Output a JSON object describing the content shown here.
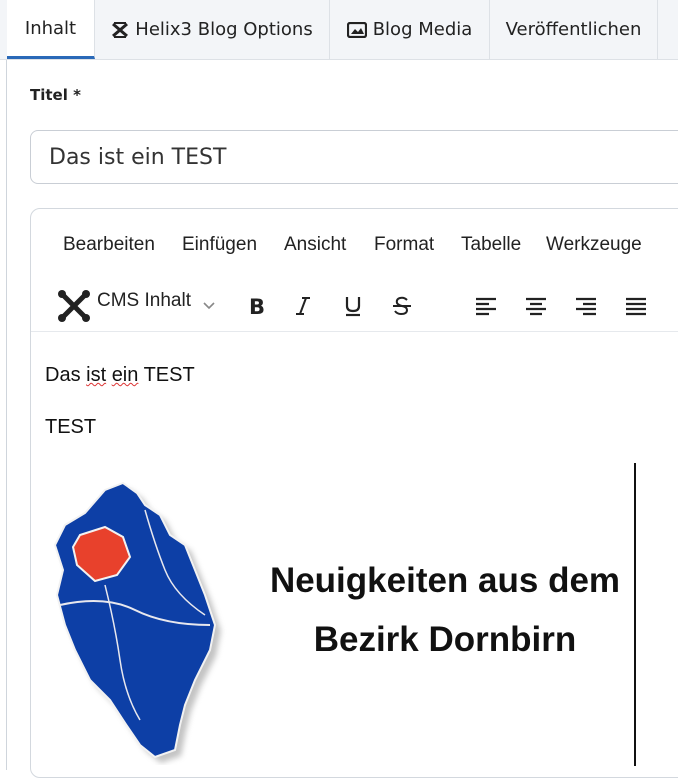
{
  "tabs": [
    {
      "label": "Inhalt",
      "active": true
    },
    {
      "label": "Helix3 Blog Options",
      "icon": "helix-icon"
    },
    {
      "label": "Blog Media",
      "icon": "image-icon"
    },
    {
      "label": "Veröffentlichen"
    }
  ],
  "form": {
    "title_label": "Titel *",
    "title_value": "Das ist ein TEST"
  },
  "editor": {
    "menu": [
      "Bearbeiten",
      "Einfügen",
      "Ansicht",
      "Format",
      "Tabelle",
      "Werkzeuge"
    ],
    "toolbar": {
      "cms_label": "CMS Inhalt",
      "buttons": [
        "bold-icon",
        "italic-icon",
        "underline-icon",
        "strikethrough-icon",
        "align-left-icon",
        "align-center-icon",
        "align-right-icon",
        "align-justify-icon"
      ]
    },
    "content": {
      "line1_a": "Das ",
      "line1_b": "ist",
      "line1_c": " ",
      "line1_d": "ein",
      "line1_e": " TEST",
      "line2": "TEST",
      "banner_line1": "Neuigkeiten aus dem",
      "banner_line2": "Bezirk Dornbirn"
    }
  },
  "colors": {
    "active_tab_accent": "#2a69b8",
    "map_blue": "#0d3fa6",
    "map_red": "#e8412c"
  }
}
